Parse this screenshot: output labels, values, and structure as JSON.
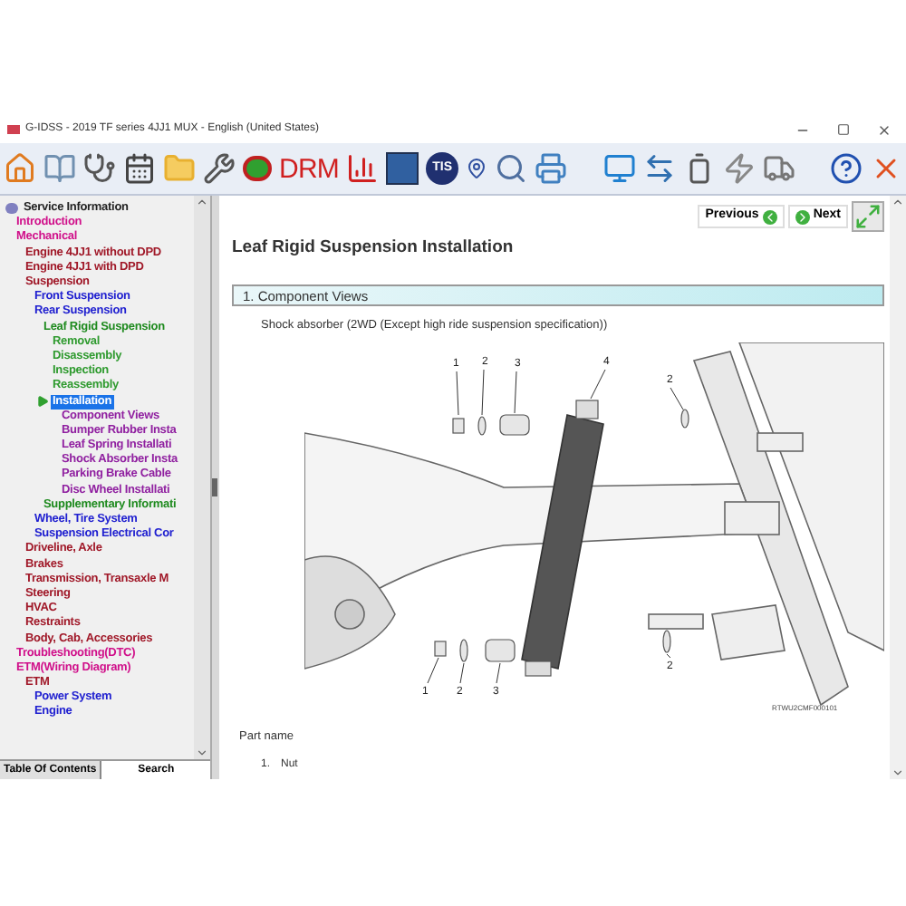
{
  "window": {
    "title": "G-IDSS - 2019 TF series 4JJ1 MUX - English (United States)"
  },
  "toolbar": {
    "drm_label": "DRM",
    "tis_label": "TIS"
  },
  "tree": [
    {
      "label": "Service Information",
      "selected": false,
      "children": [
        {
          "label": "Introduction",
          "selected": false
        },
        {
          "label": "Mechanical",
          "selected": false,
          "children": [
            {
              "label": "Engine 4JJ1 without DPD",
              "selected": false
            },
            {
              "label": "Engine 4JJ1 with DPD",
              "selected": false
            },
            {
              "label": "Suspension",
              "selected": false,
              "children": [
                {
                  "label": "Front Suspension",
                  "selected": false
                },
                {
                  "label": "Rear Suspension",
                  "selected": false,
                  "children": [
                    {
                      "label": "Leaf Rigid Suspension",
                      "selected": false,
                      "children": [
                        {
                          "label": "Removal",
                          "selected": false
                        },
                        {
                          "label": "Disassembly",
                          "selected": false
                        },
                        {
                          "label": "Inspection",
                          "selected": false
                        },
                        {
                          "label": "Reassembly",
                          "selected": false
                        },
                        {
                          "label": "Installation",
                          "selected": true,
                          "children": [
                            {
                              "label": "Component Views",
                              "selected": false
                            },
                            {
                              "label": "Bumper Rubber Insta",
                              "selected": false
                            },
                            {
                              "label": "Leaf Spring Installati",
                              "selected": false
                            },
                            {
                              "label": "Shock Absorber Insta",
                              "selected": false
                            },
                            {
                              "label": "Parking Brake Cable",
                              "selected": false
                            },
                            {
                              "label": "Disc Wheel Installati",
                              "selected": false
                            }
                          ]
                        }
                      ]
                    },
                    {
                      "label": "Supplementary Informati",
                      "selected": false
                    }
                  ]
                },
                {
                  "label": "Wheel, Tire System",
                  "selected": false
                },
                {
                  "label": "Suspension Electrical Cor",
                  "selected": false
                }
              ]
            },
            {
              "label": "Driveline, Axle",
              "selected": false
            },
            {
              "label": "Brakes",
              "selected": false
            },
            {
              "label": "Transmission, Transaxle M",
              "selected": false
            },
            {
              "label": "Steering",
              "selected": false
            },
            {
              "label": "HVAC",
              "selected": false
            },
            {
              "label": "Restraints",
              "selected": false
            },
            {
              "label": "Body, Cab, Accessories",
              "selected": false
            }
          ]
        },
        {
          "label": "Troubleshooting(DTC)",
          "selected": false
        },
        {
          "label": "ETM(Wiring Diagram)",
          "selected": false,
          "children": [
            {
              "label": "ETM",
              "selected": false,
              "children": [
                {
                  "label": "Power System",
                  "selected": false
                },
                {
                  "label": "Engine",
                  "selected": false
                }
              ]
            }
          ]
        }
      ]
    }
  ],
  "panel_tabs": [
    {
      "label": "Table Of Contents",
      "selected": true
    },
    {
      "label": "Search",
      "selected": false
    }
  ],
  "nav": {
    "previous": "Previous",
    "next": "Next"
  },
  "page": {
    "title": "Leaf Rigid Suspension Installation",
    "section": "1. Component Views",
    "caption": "Shock absorber (2WD (Except high ride suspension specification))",
    "callouts": [
      "1",
      "2",
      "3",
      "4",
      "2",
      "1",
      "2",
      "3",
      "2"
    ],
    "figure_code": "RTWU2CMF000101",
    "part_heading": "Part name",
    "parts": [
      {
        "number": "1.",
        "name": "Nut"
      }
    ]
  }
}
